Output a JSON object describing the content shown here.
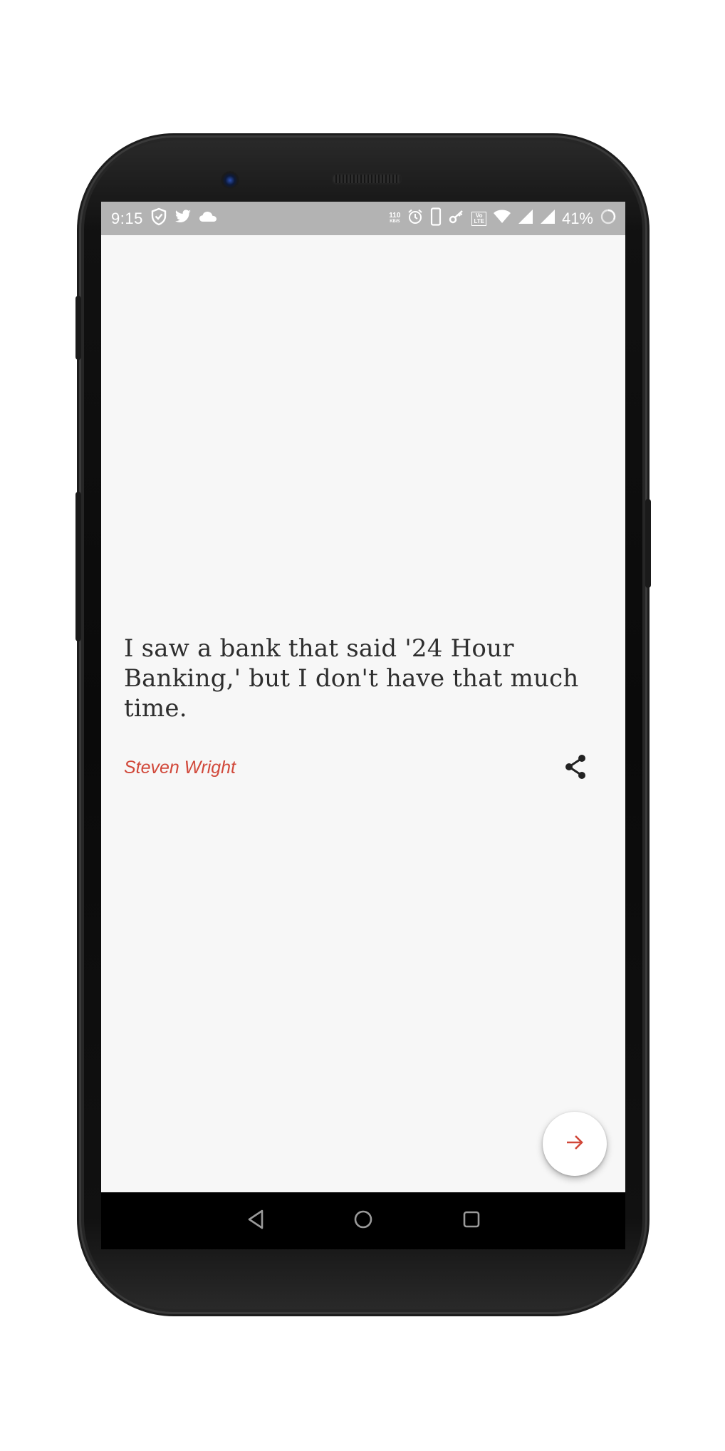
{
  "status_bar": {
    "time": "9:15",
    "net_speed_value": "110",
    "net_speed_unit": "KB/S",
    "volte_line1": "Vo",
    "volte_line2": "LTE",
    "battery_percent": "41%",
    "left_icons": [
      "shield-check-icon",
      "twitter-icon",
      "cloud-icon"
    ],
    "right_icons": [
      "alarm-icon",
      "phone-icon",
      "key-icon",
      "volte-icon",
      "wifi-icon",
      "signal-icon",
      "signal-icon",
      "battery-icon"
    ]
  },
  "quote": {
    "text": "I saw a bank that said '24 Hour Banking,' but I don't have that much time.",
    "author": "Steven Wright"
  },
  "actions": {
    "share_icon": "share-icon",
    "next_icon": "arrow-right-icon"
  },
  "navigation": {
    "buttons": [
      "back-icon",
      "home-icon",
      "recents-icon"
    ]
  },
  "colors": {
    "accent": "#d1483a",
    "status_bar": "#b3b3b3",
    "background": "#f7f7f7",
    "text": "#2e2e2e"
  }
}
